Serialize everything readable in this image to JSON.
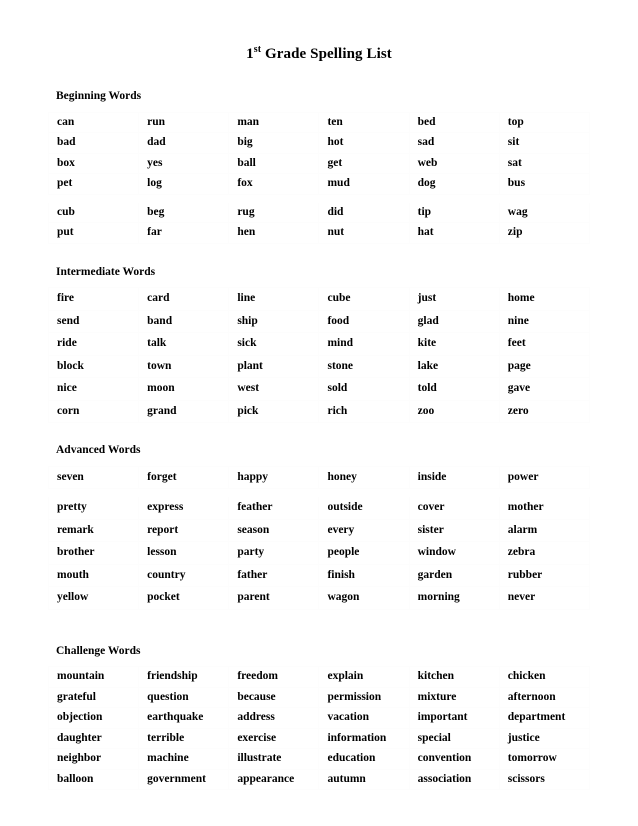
{
  "document": {
    "title_main": "1",
    "title_sup": "st",
    "title_rest": " Grade Spelling List"
  },
  "sections": [
    {
      "id": "beginning",
      "heading": "Beginning Words",
      "groups": [
        {
          "rows": [
            [
              "can",
              "run",
              "man",
              "ten",
              "bed",
              "top"
            ],
            [
              "bad",
              "dad",
              "big",
              "hot",
              "sad",
              "sit"
            ],
            [
              "box",
              "yes",
              "ball",
              "get",
              "web",
              "sat"
            ],
            [
              "pet",
              "log",
              "fox",
              "mud",
              "dog",
              "bus"
            ]
          ]
        },
        {
          "rows": [
            [
              "cub",
              "beg",
              "rug",
              "did",
              "tip",
              "wag"
            ],
            [
              "put",
              "far",
              "hen",
              "nut",
              "hat",
              "zip"
            ]
          ]
        }
      ]
    },
    {
      "id": "intermediate",
      "heading": "Intermediate Words",
      "groups": [
        {
          "rows": [
            [
              "fire",
              "card",
              "line",
              "cube",
              "just",
              "home"
            ],
            [
              "send",
              "band",
              "ship",
              "food",
              "glad",
              "nine"
            ],
            [
              "ride",
              "talk",
              "sick",
              "mind",
              "kite",
              "feet"
            ],
            [
              "block",
              "town",
              "plant",
              "stone",
              "lake",
              "page"
            ],
            [
              "nice",
              "moon",
              "west",
              "sold",
              "told",
              "gave"
            ],
            [
              "corn",
              "grand",
              "pick",
              "rich",
              "zoo",
              "zero"
            ]
          ]
        }
      ]
    },
    {
      "id": "advanced",
      "heading": "Advanced Words",
      "groups": [
        {
          "rows": [
            [
              "seven",
              "forget",
              "happy",
              "honey",
              "inside",
              "power"
            ]
          ]
        },
        {
          "rows": [
            [
              "pretty",
              "express",
              "feather",
              "outside",
              "cover",
              "mother"
            ],
            [
              "remark",
              "report",
              "season",
              "every",
              "sister",
              "alarm"
            ],
            [
              "brother",
              "lesson",
              "party",
              "people",
              "window",
              "zebra"
            ],
            [
              "mouth",
              "country",
              "father",
              "finish",
              "garden",
              "rubber"
            ],
            [
              "yellow",
              "pocket",
              "parent",
              "wagon",
              "morning",
              "never"
            ]
          ]
        }
      ]
    },
    {
      "id": "challenge",
      "heading": "Challenge Words",
      "groups": [
        {
          "rows": [
            [
              "mountain",
              "friendship",
              "freedom",
              "explain",
              "kitchen",
              "chicken"
            ],
            [
              "grateful",
              "question",
              "because",
              "permission",
              "mixture",
              "afternoon"
            ],
            [
              "objection",
              "earthquake",
              "address",
              "vacation",
              "important",
              "department"
            ],
            [
              "daughter",
              "terrible",
              "exercise",
              "information",
              "special",
              "justice"
            ],
            [
              "neighbor",
              "machine",
              "illustrate",
              "education",
              "convention",
              "tomorrow"
            ],
            [
              "balloon",
              "government",
              "appearance",
              "autumn",
              "association",
              "scissors"
            ]
          ]
        }
      ]
    }
  ]
}
